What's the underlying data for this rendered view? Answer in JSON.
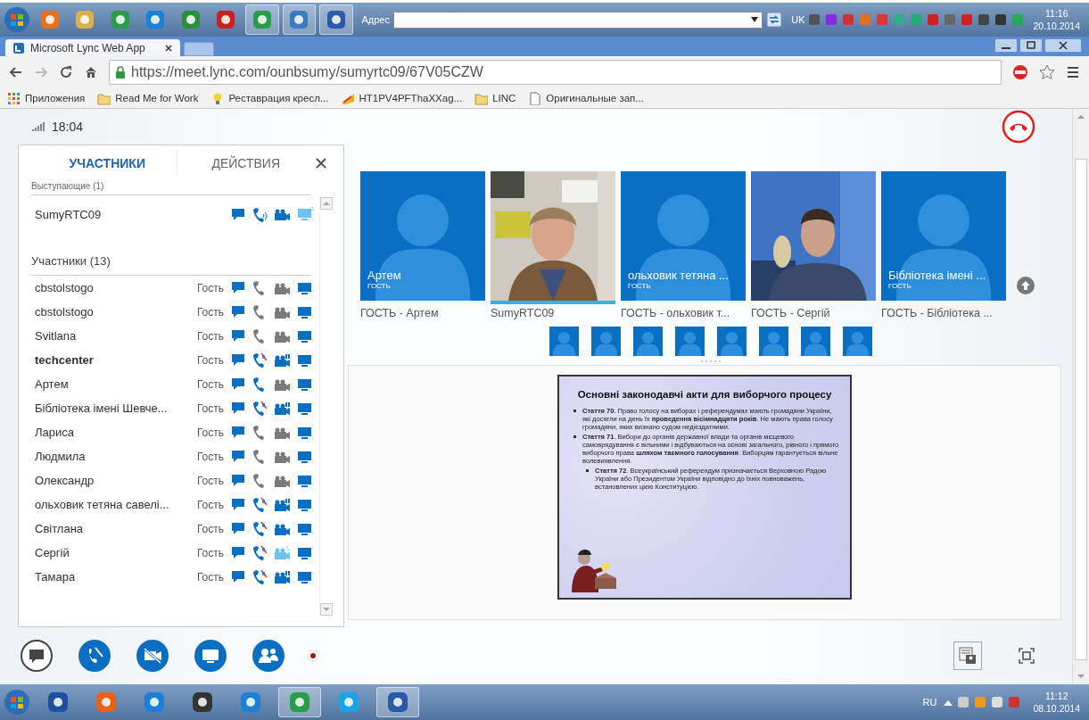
{
  "os_taskbar_top": {
    "address_label": "Адрес",
    "language": "UK",
    "time": "11:16",
    "date": "20.10.2014"
  },
  "browser": {
    "tab_title": "Microsoft Lync Web App",
    "url": "https://meet.lync.com/ounbsumy/sumyrtc09/67V05CZW",
    "bookmarks": [
      {
        "kind": "apps",
        "label": "Приложения"
      },
      {
        "kind": "folder",
        "label": "Read Me for Work"
      },
      {
        "kind": "bulb",
        "label": "Реставрация кресл..."
      },
      {
        "kind": "flag",
        "label": "HT1PV4PFThaXXag..."
      },
      {
        "kind": "folder",
        "label": "LINC"
      },
      {
        "kind": "page",
        "label": "Оригинальные зап..."
      }
    ]
  },
  "meeting": {
    "time": "18:04",
    "panel": {
      "tabs": [
        {
          "label": "УЧАСТНИКИ",
          "selected": true
        },
        {
          "label": "ДЕЙСТВИЯ",
          "selected": false
        }
      ],
      "presenters_heading": "Выступающие (1)",
      "presenters": [
        {
          "name": "SumyRTC09",
          "audio_on": true,
          "audio_muted": false,
          "audio_talking": true,
          "video_on": true,
          "video_live": false,
          "video_highlight": false,
          "share_highlight": true
        }
      ],
      "participants_heading": "Участники (13)",
      "participants": [
        {
          "name": "cbstolstogo",
          "role": "Гость",
          "bold": false,
          "audio_on": false,
          "audio_muted": false,
          "video_on": false,
          "video_live": false,
          "video_highlight": false
        },
        {
          "name": "cbstolstogo",
          "role": "Гость",
          "bold": false,
          "audio_on": false,
          "audio_muted": false,
          "video_on": false,
          "video_live": false,
          "video_highlight": false
        },
        {
          "name": "Svitlana",
          "role": "Гость",
          "bold": false,
          "audio_on": false,
          "audio_muted": false,
          "video_on": false,
          "video_live": false,
          "video_highlight": false
        },
        {
          "name": "techcenter",
          "role": "Гость",
          "bold": true,
          "audio_on": true,
          "audio_muted": true,
          "video_on": true,
          "video_live": true,
          "video_highlight": false
        },
        {
          "name": "Артем",
          "role": "Гость",
          "bold": false,
          "audio_on": true,
          "audio_muted": false,
          "video_on": false,
          "video_live": false,
          "video_highlight": false
        },
        {
          "name": "Бібліотека імені Шевче...",
          "role": "Гость",
          "bold": false,
          "audio_on": true,
          "audio_muted": true,
          "video_on": true,
          "video_live": true,
          "video_highlight": false
        },
        {
          "name": "Лариса",
          "role": "Гость",
          "bold": false,
          "audio_on": false,
          "audio_muted": false,
          "video_on": false,
          "video_live": false,
          "video_highlight": false
        },
        {
          "name": "Людмила",
          "role": "Гость",
          "bold": false,
          "audio_on": false,
          "audio_muted": false,
          "video_on": false,
          "video_live": false,
          "video_highlight": false
        },
        {
          "name": "Олександр",
          "role": "Гость",
          "bold": false,
          "audio_on": false,
          "audio_muted": false,
          "video_on": false,
          "video_live": false,
          "video_highlight": false
        },
        {
          "name": "ольховик тетяна савелі...",
          "role": "Гость",
          "bold": false,
          "audio_on": true,
          "audio_muted": true,
          "video_on": true,
          "video_live": true,
          "video_highlight": false
        },
        {
          "name": "Світлана",
          "role": "Гость",
          "bold": false,
          "audio_on": true,
          "audio_muted": true,
          "video_on": true,
          "video_live": false,
          "video_highlight": false
        },
        {
          "name": "Сергій",
          "role": "Гость",
          "bold": false,
          "audio_on": true,
          "audio_muted": true,
          "video_on": true,
          "video_live": false,
          "video_highlight": true
        },
        {
          "name": "Тамара",
          "role": "Гость",
          "bold": false,
          "audio_on": true,
          "audio_muted": true,
          "video_on": true,
          "video_live": true,
          "video_highlight": false
        }
      ]
    },
    "video_tiles": [
      {
        "kind": "avatar",
        "name": "Артем",
        "role": "ГОСТЬ",
        "caption": "ГОСТЬ - Артем",
        "selected": false
      },
      {
        "kind": "picture",
        "caption": "SumyRTC09",
        "selected": true
      },
      {
        "kind": "avatar",
        "name": "ольховик тетяна ...",
        "role": "ГОСТЬ",
        "caption": "ГОСТЬ - ольховик т...",
        "selected": false
      },
      {
        "kind": "picture",
        "caption": "ГОСТЬ - Сергій",
        "selected": false
      },
      {
        "kind": "avatar",
        "name": "Бібліотека імені ...",
        "role": "ГОСТЬ",
        "caption": "ГОСТЬ - Бібліотека ...",
        "selected": false
      }
    ],
    "thumbnails": [
      {
        "kind": "avatar"
      },
      {
        "kind": "avatar"
      },
      {
        "kind": "avatar"
      },
      {
        "kind": "avatar"
      },
      {
        "kind": "avatar"
      },
      {
        "kind": "avatar"
      },
      {
        "kind": "avatar"
      },
      {
        "kind": "avatar"
      }
    ],
    "slide": {
      "title": "Основні законодавчі акти для виборчого процесу",
      "bullets": [
        {
          "text": "**Стаття 70**. Право голосу на виборах і референдумах мають громадяни України, які досягли на день їх **проведення вісімнадцяти років**. Не мають права голосу громадяни, яких визнано судом недієздатними."
        },
        {
          "text": "**Стаття 71**. Вибори до органів державної влади та органів місцевого самоврядування є вільними і відбуваються на основі загального, рівного і прямого виборчого права **шляхом таємного голосування**. Виборцям гарантується вільне волевиявлення.",
          "children": [
            {
              "text": "**Стаття 72**. Всеукраїнський референдум призначається Верховною Радою України або Президентом України відповідно до їхніх повноважень, встановлених цією Конституцією."
            }
          ]
        }
      ]
    },
    "controls": [
      {
        "kind": "chat"
      },
      {
        "kind": "audio-muted"
      },
      {
        "kind": "video-muted"
      },
      {
        "kind": "present"
      },
      {
        "kind": "people"
      },
      {
        "kind": "record"
      }
    ]
  },
  "os_taskbar_bottom": {
    "language": "RU",
    "time": "11:12",
    "date": "08.10.2014"
  }
}
